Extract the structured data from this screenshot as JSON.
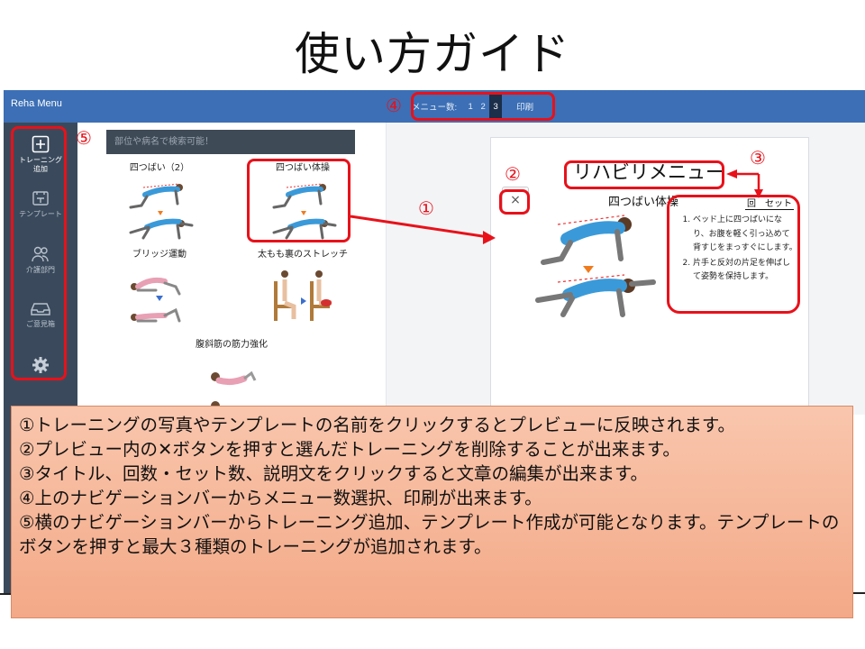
{
  "slide_title": "使い方ガイド",
  "app": {
    "name": "Reha Menu",
    "nav": {
      "menu_count_label": "メニュー数:",
      "counts": [
        "1",
        "2",
        "3"
      ],
      "selected": "3",
      "print_label": "印刷"
    },
    "sidebar": [
      {
        "label": "トレーニング\n追加",
        "icon": "plus-square-icon",
        "active": true
      },
      {
        "label": "テンプレート",
        "icon": "template-icon",
        "active": false
      },
      {
        "label": "介護部門",
        "icon": "people-icon",
        "active": false
      },
      {
        "label": "ご意見箱",
        "icon": "inbox-icon",
        "active": false
      },
      {
        "label": "",
        "icon": "gear-icon",
        "active": false
      }
    ],
    "search_placeholder": "部位や病名で検索可能！",
    "exercises": [
      {
        "name": "四つばい（2）"
      },
      {
        "name": "四つばい体操"
      },
      {
        "name": "ブリッジ運動"
      },
      {
        "name": "太もも裏のストレッチ"
      },
      {
        "name": "腹斜筋の筋力強化"
      }
    ],
    "preview": {
      "title": "リハビリメニュー",
      "close_label": "×",
      "exercise_name": "四つばい体操",
      "reps_label": "回　セット",
      "steps": [
        "ベッド上に四つばいになり、お腹を軽く引っ込めて背すじをまっすぐにします。",
        "片手と反対の片足を伸ばして姿勢を保持します。"
      ]
    }
  },
  "callouts": [
    "①",
    "②",
    "③",
    "④",
    "⑤"
  ],
  "instructions": [
    "①トレーニングの写真やテンプレートの名前をクリックするとプレビューに反映されます。",
    "②プレビュー内の✕ボタンを押すと選んだトレーニングを削除することが出来ます。",
    "③タイトル、回数・セット数、説明文をクリックすると文章の編集が出来ます。",
    "④上のナビゲーションバーからメニュー数選択、印刷が出来ます。",
    "⑤横のナビゲーションバーからトレーニング追加、テンプレート作成が可能となります。テンプレートのボタンを押すと最大３種類のトレーニングが追加されます。"
  ],
  "colors": {
    "topbar": "#3c6fb5",
    "sidebar": "#3a4a5c",
    "highlight": "#e8111a",
    "infobox": "#f4ad8c"
  }
}
